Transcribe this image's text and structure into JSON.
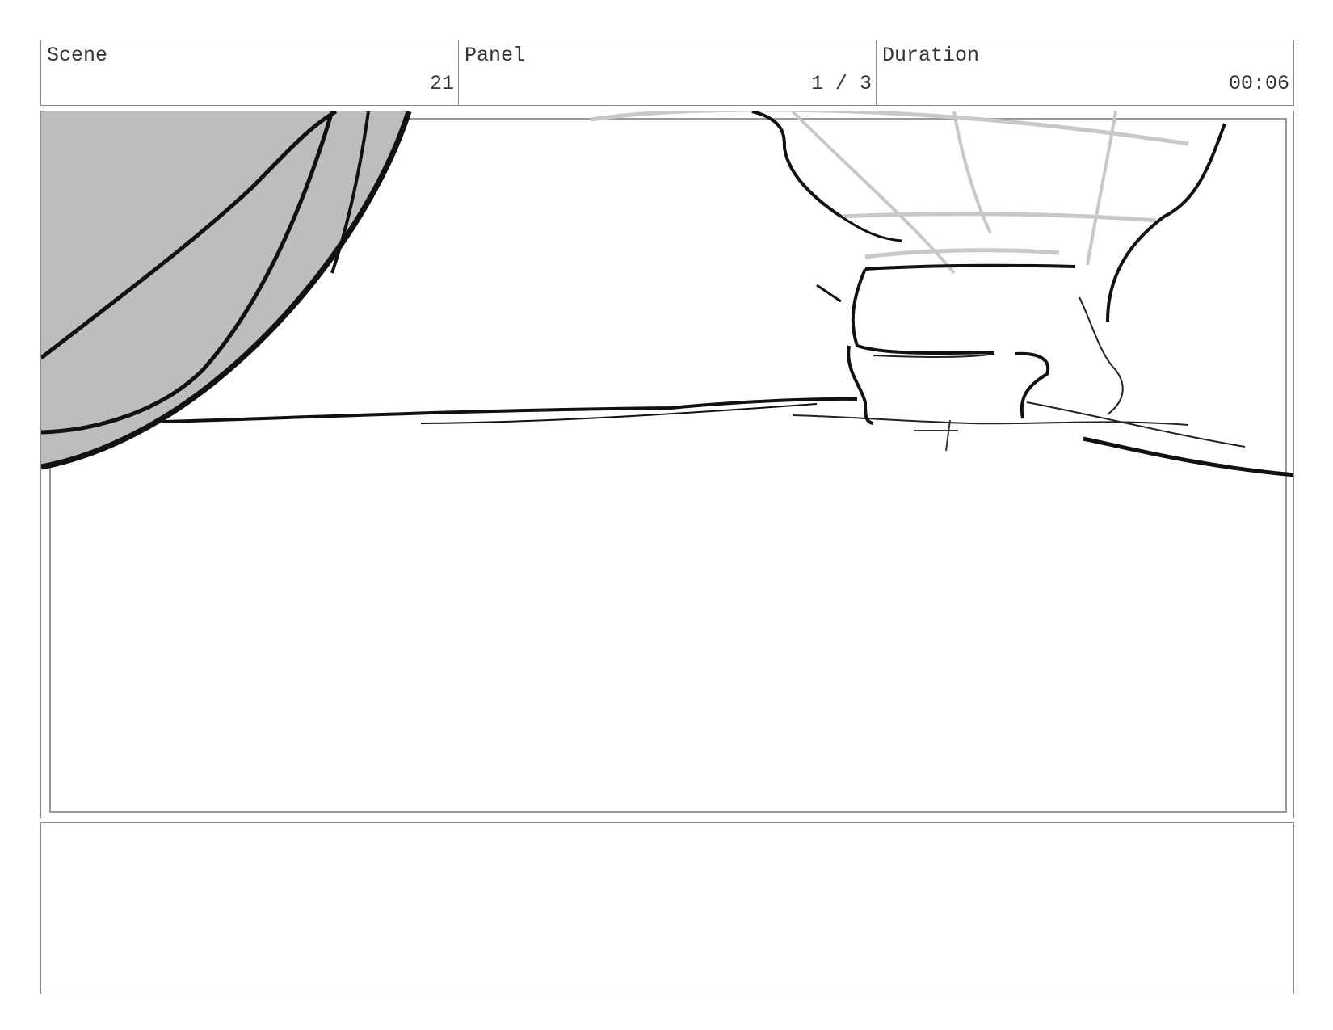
{
  "header": {
    "scene_label": "Scene",
    "scene_value": "21",
    "panel_label": "Panel",
    "panel_value": "1 / 3",
    "duration_label": "Duration",
    "duration_value": "00:06"
  },
  "notes": {
    "text": ""
  }
}
